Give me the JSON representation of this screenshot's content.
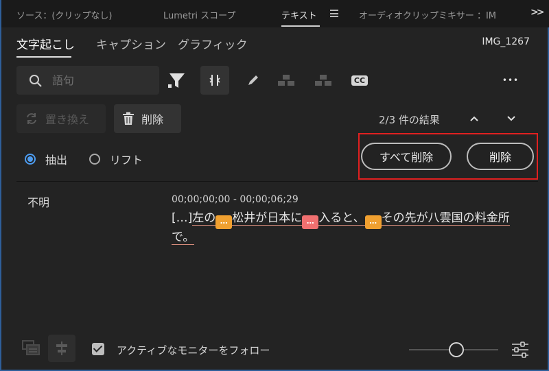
{
  "panel_tabs": [
    {
      "label": "ソース：(クリップなし)"
    },
    {
      "label": "Lumetri スコープ"
    },
    {
      "label": "テキスト"
    },
    {
      "label": "オーディオクリップミキサー ：IM"
    }
  ],
  "sub_tabs": [
    {
      "label": "文字起こし"
    },
    {
      "label": "キャプション"
    },
    {
      "label": "グラフィック"
    }
  ],
  "clip_name": "IMG_1267",
  "search": {
    "placeholder": "語句"
  },
  "cc_label": "CC",
  "more_label": "•••",
  "replace_label": "置き換え",
  "delete_label": "削除",
  "results_label": "2/3 件の結果",
  "radio": {
    "extract": "抽出",
    "lift": "リフト",
    "selected": "extract"
  },
  "delete_all_label": "すべて削除",
  "delete_pill_label": "削除",
  "transcript": {
    "speaker": "不明",
    "timecode": "00;00;00;00 - 00;00;06;29",
    "prefix": "[…]",
    "seg1": "左の",
    "seg2": "松井が日本に",
    "seg3": "入ると、",
    "seg4": "その先が八雲国の料金所で。",
    "gap_glyph": "…"
  },
  "follow_label": "アクティブなモニターをフォロー",
  "colors": {
    "accent": "#4d9cf0",
    "gap_orange": "#f0a030",
    "gap_red": "#f07070",
    "highlight": "#e02020"
  }
}
